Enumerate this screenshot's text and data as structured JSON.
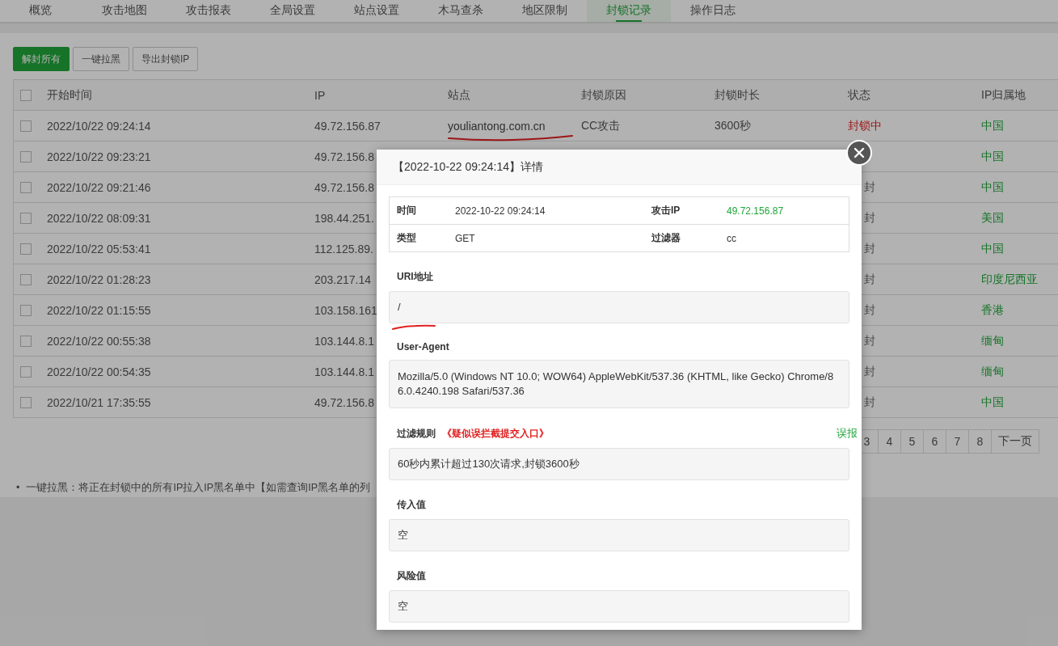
{
  "tabs": [
    {
      "label": "概览",
      "selected": false
    },
    {
      "label": "攻击地图",
      "selected": false
    },
    {
      "label": "攻击报表",
      "selected": false
    },
    {
      "label": "全局设置",
      "selected": false
    },
    {
      "label": "站点设置",
      "selected": false
    },
    {
      "label": "木马查杀",
      "selected": false
    },
    {
      "label": "地区限制",
      "selected": false
    },
    {
      "label": "封锁记录",
      "selected": true
    },
    {
      "label": "操作日志",
      "selected": false
    }
  ],
  "toolbar": [
    {
      "label": "解封所有",
      "kind": "primary"
    },
    {
      "label": "一键拉黑",
      "kind": "default"
    },
    {
      "label": "导出封锁IP",
      "kind": "default"
    }
  ],
  "table": {
    "select_all_checked": false,
    "columns": [
      "开始时间",
      "IP",
      "站点",
      "封锁原因",
      "封锁时长",
      "状态",
      "IP归属地"
    ],
    "rows": [
      {
        "checked": false,
        "time": "2022/10/22 09:24:14",
        "ip": "49.72.156.87",
        "site": "youliantong.com.cn",
        "site_underlined": true,
        "reason": "CC攻击",
        "duration": "3600秒",
        "status": "封锁中",
        "blocked": true,
        "region": "中国"
      },
      {
        "checked": false,
        "time": "2022/10/22 09:23:21",
        "ip": "49.72.156.8",
        "region": "中国"
      },
      {
        "checked": false,
        "time": "2022/10/22 09:21:46",
        "ip": "49.72.156.8",
        "status": "封",
        "blocked": false,
        "region": "中国"
      },
      {
        "checked": false,
        "time": "2022/10/22 08:09:31",
        "ip": "198.44.251.",
        "status": "封",
        "blocked": false,
        "region": "美国"
      },
      {
        "checked": false,
        "time": "2022/10/22 05:53:41",
        "ip": "112.125.89.",
        "status": "封",
        "blocked": false,
        "region": "中国"
      },
      {
        "checked": false,
        "time": "2022/10/22 01:28:23",
        "ip": "203.217.14",
        "status": "封",
        "blocked": false,
        "region": "印度尼西亚"
      },
      {
        "checked": false,
        "time": "2022/10/22 01:15:55",
        "ip": "103.158.161",
        "status": "封",
        "blocked": false,
        "region": "香港"
      },
      {
        "checked": false,
        "time": "2022/10/22 00:55:38",
        "ip": "103.144.8.1",
        "status": "封",
        "blocked": false,
        "region": "缅甸"
      },
      {
        "checked": false,
        "time": "2022/10/22 00:54:35",
        "ip": "103.144.8.1",
        "status": "封",
        "blocked": false,
        "region": "缅甸"
      },
      {
        "checked": false,
        "time": "2022/10/21 17:35:55",
        "ip": "49.72.156.8",
        "status": "封",
        "blocked": false,
        "region": "中国"
      }
    ]
  },
  "pagination": [
    "3",
    "4",
    "5",
    "6",
    "7",
    "8",
    "下一页"
  ],
  "notes": [
    {
      "bullet": "•",
      "text": "一键拉黑：将正在封锁中的所有IP拉入IP黑名单中【如需查询IP黑名单的列"
    }
  ],
  "dialog": {
    "title": "【2022-10-22 09:24:14】详情",
    "info": [
      {
        "label": "时间",
        "value": "2022-10-22 09:24:14",
        "label2": "攻击IP",
        "value2": "49.72.156.87"
      },
      {
        "label": "类型",
        "value": "GET",
        "label2": "过滤器",
        "value2": "cc"
      }
    ],
    "uri": {
      "label": "URI地址",
      "value": "/",
      "underlined": true
    },
    "user_agent": {
      "label": "User-Agent",
      "value": "Mozilla/5.0 (Windows NT 10.0; WOW64) AppleWebKit/537.36 (KHTML, like Gecko) Chrome/86.0.4240.198 Safari/537.36"
    },
    "rule": {
      "label": "过滤规则",
      "link": "《疑似误拦截提交入口》",
      "report": "误报",
      "value": "60秒内累计超过130次请求,封锁3600秒"
    },
    "input_value": {
      "label": "传入值",
      "value": "空"
    },
    "risk_value": {
      "label": "风险值",
      "value": "空"
    }
  }
}
